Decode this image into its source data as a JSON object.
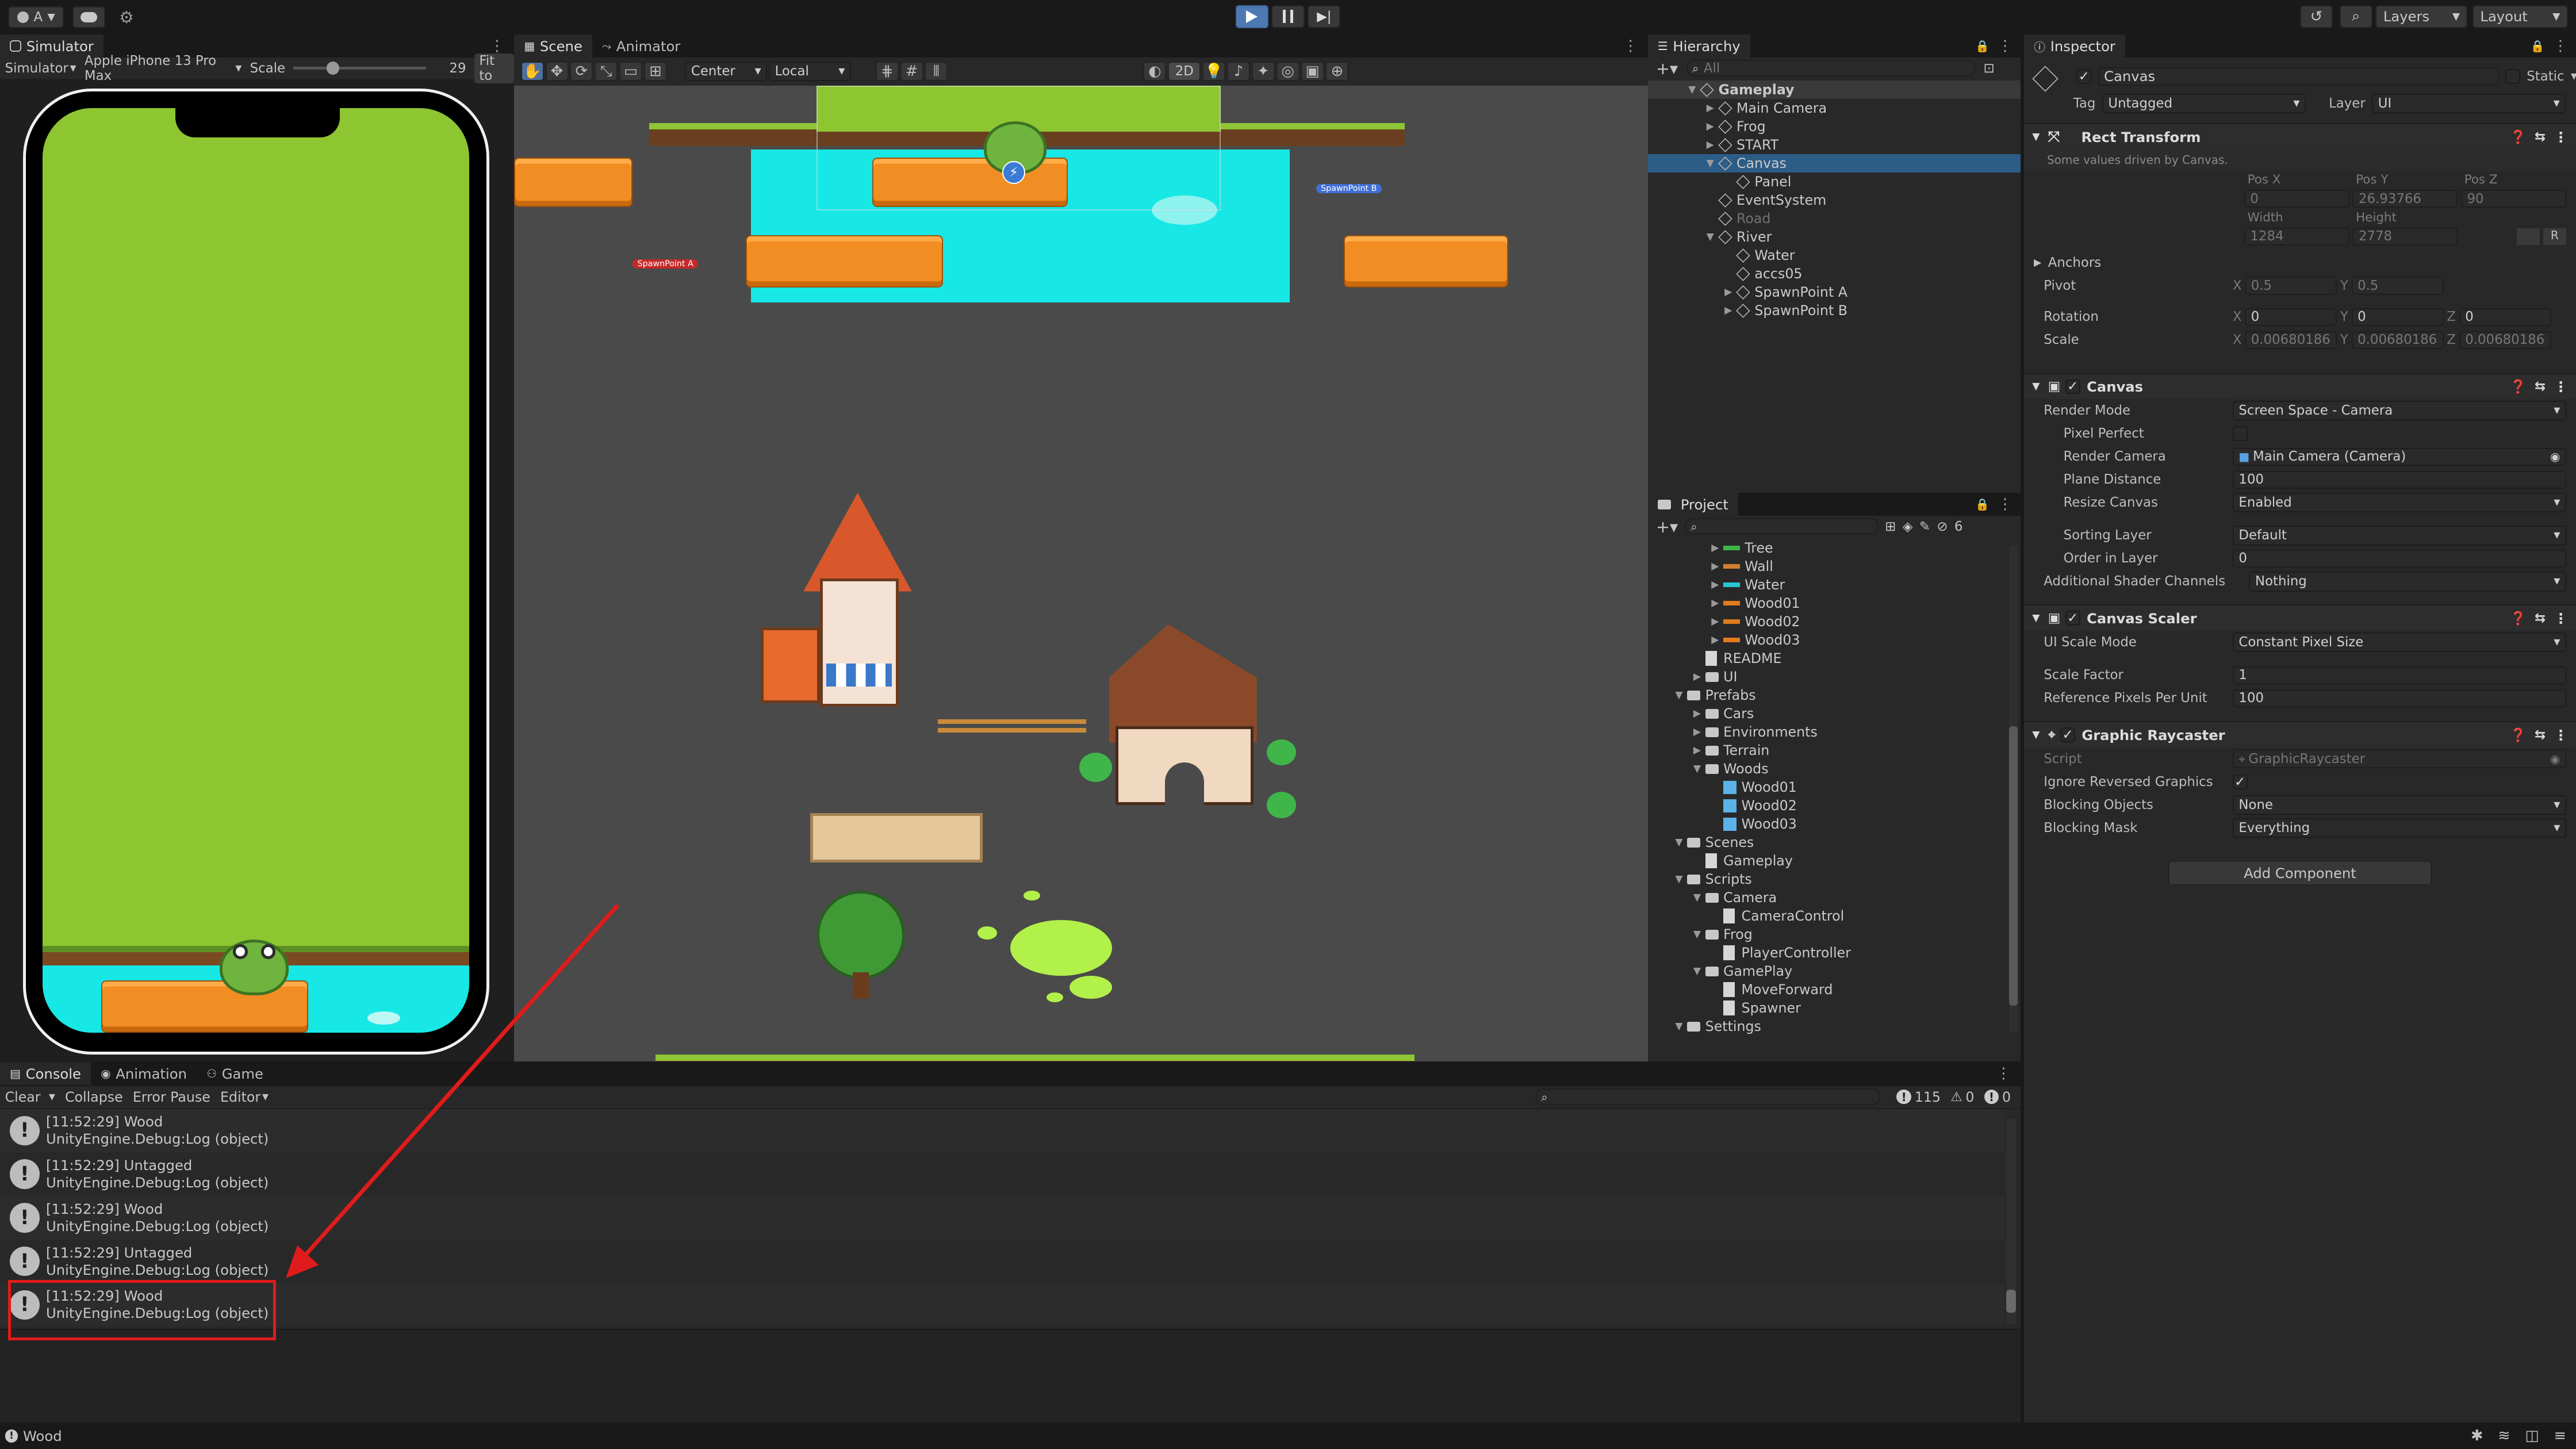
{
  "toolbar": {
    "account": "A",
    "layers": "Layers",
    "layout": "Layout"
  },
  "simulator": {
    "tab": "Simulator",
    "mode": "Simulator",
    "device": "Apple iPhone 13 Pro Max",
    "scale_label": "Scale",
    "scale_value": "29",
    "fit": "Fit to"
  },
  "scene": {
    "tab_scene": "Scene",
    "tab_animator": "Animator",
    "pivot": "Center",
    "space": "Local",
    "mode2d": "2D",
    "spawn_a": "SpawnPoint A",
    "spawn_b": "SpawnPoint B"
  },
  "hierarchy": {
    "tab": "Hierarchy",
    "search": "All",
    "items": [
      {
        "label": "Gameplay",
        "depth": 0,
        "root": true
      },
      {
        "label": "Main Camera",
        "depth": 1
      },
      {
        "label": "Frog",
        "depth": 1
      },
      {
        "label": "START",
        "depth": 1
      },
      {
        "label": "Canvas",
        "depth": 1,
        "selected": true
      },
      {
        "label": "Panel",
        "depth": 2
      },
      {
        "label": "EventSystem",
        "depth": 1
      },
      {
        "label": "Road",
        "depth": 1,
        "dim": true
      },
      {
        "label": "River",
        "depth": 1
      },
      {
        "label": "Water",
        "depth": 2
      },
      {
        "label": "accs05",
        "depth": 2
      },
      {
        "label": "SpawnPoint A",
        "depth": 2
      },
      {
        "label": "SpawnPoint B",
        "depth": 2
      }
    ]
  },
  "project": {
    "tab": "Project",
    "count": "6",
    "items": [
      {
        "label": "Tree",
        "depth": 2,
        "color": "#3fb54a"
      },
      {
        "label": "Wall",
        "depth": 2,
        "color": "#d08030"
      },
      {
        "label": "Water",
        "depth": 2,
        "color": "#29c6d3"
      },
      {
        "label": "Wood01",
        "depth": 2,
        "color": "#e07b1e"
      },
      {
        "label": "Wood02",
        "depth": 2,
        "color": "#e07b1e"
      },
      {
        "label": "Wood03",
        "depth": 2,
        "color": "#e07b1e"
      },
      {
        "label": "README",
        "depth": 1,
        "doc": true
      },
      {
        "label": "UI",
        "depth": 1,
        "folder": true
      },
      {
        "label": "Prefabs",
        "depth": 0,
        "folder": true
      },
      {
        "label": "Cars",
        "depth": 1,
        "folder": true
      },
      {
        "label": "Environments",
        "depth": 1,
        "folder": true
      },
      {
        "label": "Terrain",
        "depth": 1,
        "folder": true
      },
      {
        "label": "Woods",
        "depth": 1,
        "folder": true
      },
      {
        "label": "Wood01",
        "depth": 2,
        "prefab": true
      },
      {
        "label": "Wood02",
        "depth": 2,
        "prefab": true
      },
      {
        "label": "Wood03",
        "depth": 2,
        "prefab": true
      },
      {
        "label": "Scenes",
        "depth": 0,
        "folder": true
      },
      {
        "label": "Gameplay",
        "depth": 1,
        "doc": true
      },
      {
        "label": "Scripts",
        "depth": 0,
        "folder": true
      },
      {
        "label": "Camera",
        "depth": 1,
        "folder": true
      },
      {
        "label": "CameraControl",
        "depth": 2,
        "doc": true
      },
      {
        "label": "Frog",
        "depth": 1,
        "folder": true
      },
      {
        "label": "PlayerController",
        "depth": 2,
        "doc": true
      },
      {
        "label": "GamePlay",
        "depth": 1,
        "folder": true
      },
      {
        "label": "MoveForward",
        "depth": 2,
        "doc": true
      },
      {
        "label": "Spawner",
        "depth": 2,
        "doc": true
      },
      {
        "label": "Settings",
        "depth": 0,
        "folder": true
      }
    ]
  },
  "inspector": {
    "tab": "Inspector",
    "object": "Canvas",
    "static": "Static",
    "tag_label": "Tag",
    "tag": "Untagged",
    "layer_label": "Layer",
    "layer": "UI",
    "rect": {
      "title": "Rect Transform",
      "note": "Some values driven by Canvas.",
      "posx_l": "Pos X",
      "posy_l": "Pos Y",
      "posz_l": "Pos Z",
      "posx": "0",
      "posy": "26.93766",
      "posz": "90",
      "width_l": "Width",
      "height_l": "Height",
      "width": "1284",
      "height": "2778",
      "anchors": "Anchors",
      "pivot": "Pivot",
      "pivot_x": "0.5",
      "pivot_y": "0.5",
      "rotation": "Rotation",
      "rot_x": "0",
      "rot_y": "0",
      "rot_z": "0",
      "scale": "Scale",
      "sc_x": "0.00680186",
      "sc_y": "0.00680186",
      "sc_z": "0.00680186",
      "x": "X",
      "y": "Y",
      "z": "Z"
    },
    "canvas": {
      "title": "Canvas",
      "render_mode_l": "Render Mode",
      "render_mode": "Screen Space - Camera",
      "pixel_perfect_l": "Pixel Perfect",
      "render_camera_l": "Render Camera",
      "render_camera": "Main Camera (Camera)",
      "plane_distance_l": "Plane Distance",
      "plane_distance": "100",
      "resize_l": "Resize Canvas",
      "resize": "Enabled",
      "sorting_layer_l": "Sorting Layer",
      "sorting_layer": "Default",
      "order_l": "Order in Layer",
      "order": "0",
      "shader_l": "Additional Shader Channels",
      "shader": "Nothing"
    },
    "scaler": {
      "title": "Canvas Scaler",
      "mode_l": "UI Scale Mode",
      "mode": "Constant Pixel Size",
      "factor_l": "Scale Factor",
      "factor": "1",
      "ppu_l": "Reference Pixels Per Unit",
      "ppu": "100"
    },
    "raycaster": {
      "title": "Graphic Raycaster",
      "script_l": "Script",
      "script": "GraphicRaycaster",
      "ignore_l": "Ignore Reversed Graphics",
      "blocking_l": "Blocking Objects",
      "blocking": "None",
      "mask_l": "Blocking Mask",
      "mask": "Everything"
    },
    "add_component": "Add Component"
  },
  "console": {
    "tab_console": "Console",
    "tab_animation": "Animation",
    "tab_game": "Game",
    "clear": "Clear",
    "collapse": "Collapse",
    "error_pause": "Error Pause",
    "editor": "Editor",
    "count_log": "115",
    "count_warn": "0",
    "count_err": "0",
    "logs": [
      {
        "time": "[11:52:29] Wood",
        "stack": "UnityEngine.Debug:Log (object)"
      },
      {
        "time": "[11:52:29] Untagged",
        "stack": "UnityEngine.Debug:Log (object)"
      },
      {
        "time": "[11:52:29] Wood",
        "stack": "UnityEngine.Debug:Log (object)"
      },
      {
        "time": "[11:52:29] Untagged",
        "stack": "UnityEngine.Debug:Log (object)"
      },
      {
        "time": "[11:52:29] Wood",
        "stack": "UnityEngine.Debug:Log (object)"
      }
    ]
  },
  "status": {
    "text": "Wood"
  },
  "colors": {
    "highlight": "#e01b1b",
    "grass": "#8ec632",
    "water": "#17e8e6",
    "plank": "#f18d22"
  }
}
